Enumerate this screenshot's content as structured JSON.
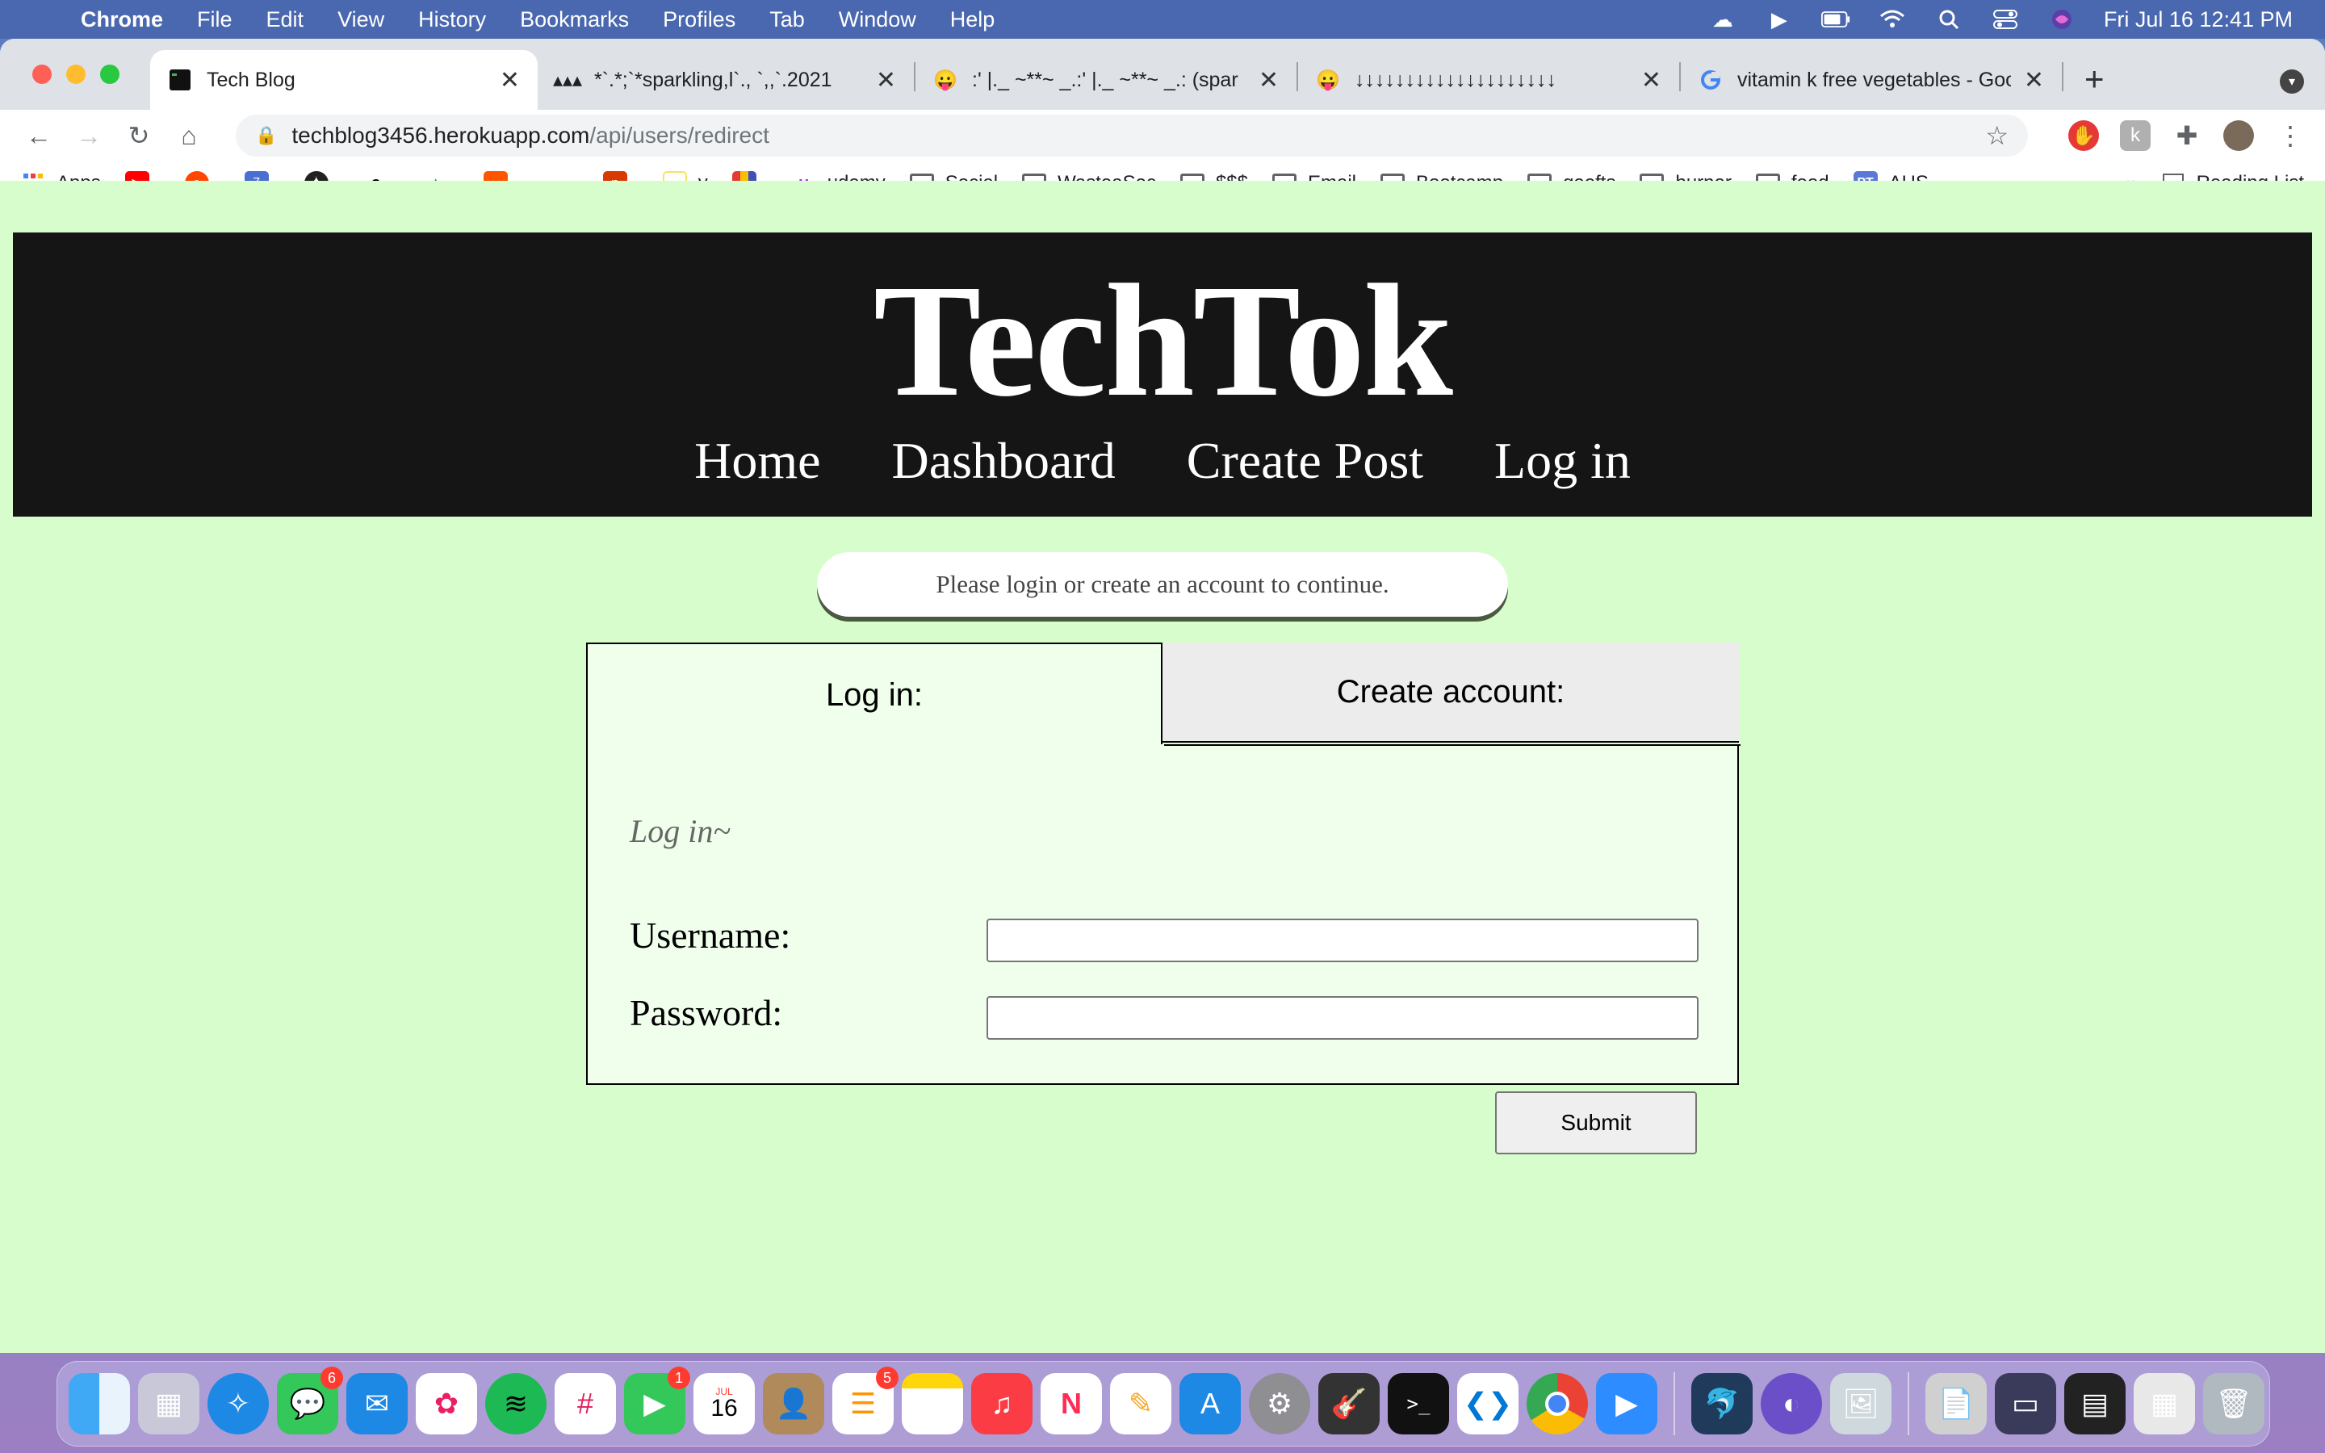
{
  "menubar": {
    "app": "Chrome",
    "items": [
      "File",
      "Edit",
      "View",
      "History",
      "Bookmarks",
      "Profiles",
      "Tab",
      "Window",
      "Help"
    ],
    "clock": "Fri Jul 16  12:41 PM"
  },
  "tabs": [
    {
      "title": "Tech Blog",
      "favicon": "terminal-icon",
      "active": true
    },
    {
      "title": "*`.*;`*sparkling,l`., `,,`.2021",
      "favicon": "dots-icon"
    },
    {
      "title": ":' |._ ~**~ _.:' |._ ~**~ _.: (spar",
      "favicon": "smiley-icon"
    },
    {
      "title": "↓↓↓↓↓↓↓↓↓↓↓↓↓↓↓↓↓↓↓↓",
      "favicon": "smiley-tongue-icon"
    },
    {
      "title": "vitamin k free vegetables - Goo",
      "favicon": "google-icon"
    }
  ],
  "omnibox": {
    "host": "techblog3456.herokuapp.com",
    "path": "/api/users/redirect"
  },
  "bookmarks": [
    {
      "label": "Apps",
      "icon": "apps-grid-icon",
      "color": "#4285f4"
    },
    {
      "label": "",
      "icon": "youtube-icon",
      "color": "#ff0000"
    },
    {
      "label": "",
      "icon": "reddit-icon",
      "color": "#ff4500"
    },
    {
      "label": "",
      "icon": "calendar-ext-icon",
      "color": "#4a6fd1"
    },
    {
      "label": "",
      "icon": "compass-icon",
      "color": "#222222"
    },
    {
      "label": "",
      "icon": "amazon-icon",
      "color": "#000000"
    },
    {
      "label": "",
      "icon": "drive-icon",
      "color": "#34a853"
    },
    {
      "label": "",
      "icon": "soundcloud-icon",
      "color": "#ff5500"
    },
    {
      "label": "",
      "icon": "parallelogram-icon",
      "color": "#2a9fd6"
    },
    {
      "label": "",
      "icon": "office-icon",
      "color": "#d83b01"
    },
    {
      "label": "y",
      "icon": "blank-page-icon",
      "color": "#f8e45c"
    },
    {
      "label": "",
      "icon": "books-icon",
      "color": "#7b4fc9"
    },
    {
      "label": "udemy",
      "icon": "udemy-icon",
      "color": "#a435f0"
    },
    {
      "label": "Social",
      "icon": "folder-icon"
    },
    {
      "label": "WasteaSec",
      "icon": "folder-icon"
    },
    {
      "label": "$$$",
      "icon": "folder-icon"
    },
    {
      "label": "Email",
      "icon": "folder-icon"
    },
    {
      "label": "Bootcamp",
      "icon": "folder-icon"
    },
    {
      "label": "geefts",
      "icon": "folder-icon"
    },
    {
      "label": "burner",
      "icon": "folder-icon"
    },
    {
      "label": "food",
      "icon": "folder-icon"
    },
    {
      "label": "AHS",
      "icon": "ahs-icon",
      "color": "#5a78d6"
    }
  ],
  "bookmarks_more": "»",
  "reading_list": "Reading List",
  "site": {
    "title": "TechTok",
    "nav": [
      "Home",
      "Dashboard",
      "Create Post",
      "Log in"
    ],
    "notice": "Please login or create an account to continue.",
    "tab_login": "Log in:",
    "tab_create": "Create account:",
    "form_heading": "Log in~",
    "username_label": "Username:",
    "password_label": "Password:",
    "submit": "Submit"
  },
  "dock": {
    "badges": {
      "messages": "6",
      "facetime": "1",
      "reminders": "5"
    },
    "calendar_month": "JUL",
    "calendar_day": "16"
  },
  "colors": {
    "page_bg": "#d7fdcc",
    "header_bg": "#151515",
    "panel_bg": "#efffec"
  }
}
